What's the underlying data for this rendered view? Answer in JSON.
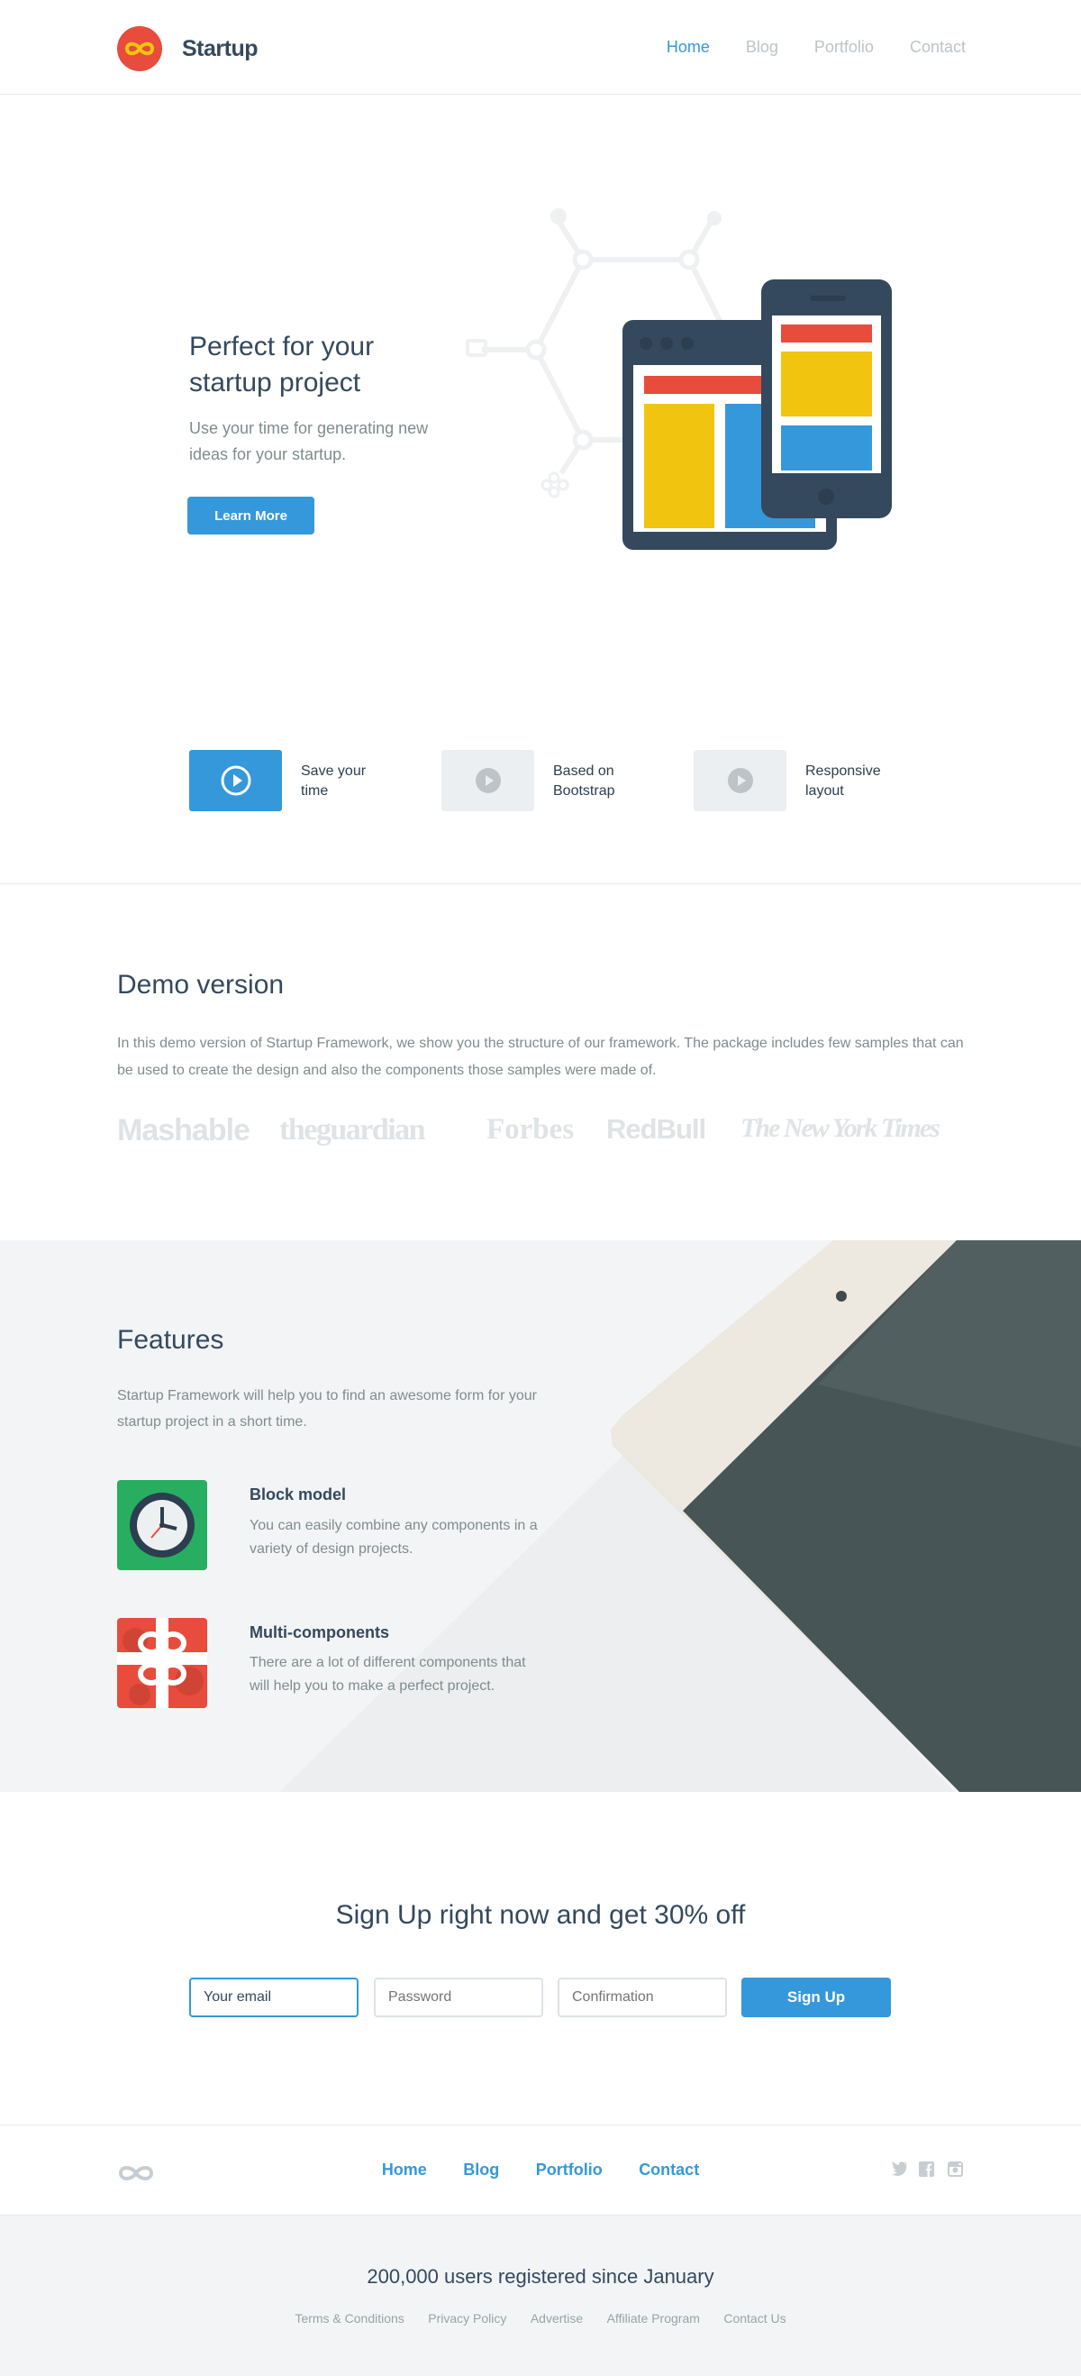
{
  "header": {
    "brand": "Startup",
    "nav": [
      "Home",
      "Blog",
      "Portfolio",
      "Contact"
    ],
    "active_nav": "Home"
  },
  "hero": {
    "title": "Perfect for your startup project",
    "text": "Use your time for generating new ideas for your startup.",
    "button": "Learn More"
  },
  "tiles": [
    {
      "label": "Save your time",
      "active": true
    },
    {
      "label": "Based on Bootstrap",
      "active": false
    },
    {
      "label": "Responsive layout",
      "active": false
    }
  ],
  "demo": {
    "title": "Demo version",
    "text": "In this demo version of Startup Framework, we show you the structure of our framework. The package includes few samples that can be used to create the design and also the components those samples were made of.",
    "press": [
      "Mashable",
      "theguardian",
      "Forbes",
      "RedBull",
      "The New York Times"
    ]
  },
  "features": {
    "title": "Features",
    "text": "Startup Framework will help you to find an awesome form for your startup project in a short time.",
    "items": [
      {
        "title": "Block model",
        "text": "You can easily combine any components in a variety of design projects."
      },
      {
        "title": "Multi-components",
        "text": "There are a lot of different components that will help you to make a perfect project."
      }
    ]
  },
  "signup": {
    "title": "Sign Up right now and get 30% off",
    "email_value": "Your email",
    "password_placeholder": "Password",
    "confirmation_placeholder": "Confirmation",
    "button": "Sign Up"
  },
  "footer": {
    "nav": [
      "Home",
      "Blog",
      "Portfolio",
      "Contact"
    ],
    "headline": "200,000 users registered since January",
    "links": [
      "Terms & Conditions",
      "Privacy Policy",
      "Advertise",
      "Affiliate Program",
      "Contact Us"
    ]
  },
  "colors": {
    "accent": "#3498db",
    "brand_red": "#e74c3c",
    "yellow": "#f1c40f",
    "navy": "#34495e",
    "green": "#27ae60"
  },
  "icons": {
    "logo": "infinity-icon",
    "tiles": "play-circle-icon",
    "feature_1": "clock-icon",
    "feature_2": "gift-icon",
    "social": [
      "twitter-icon",
      "facebook-icon",
      "instagram-icon"
    ]
  }
}
